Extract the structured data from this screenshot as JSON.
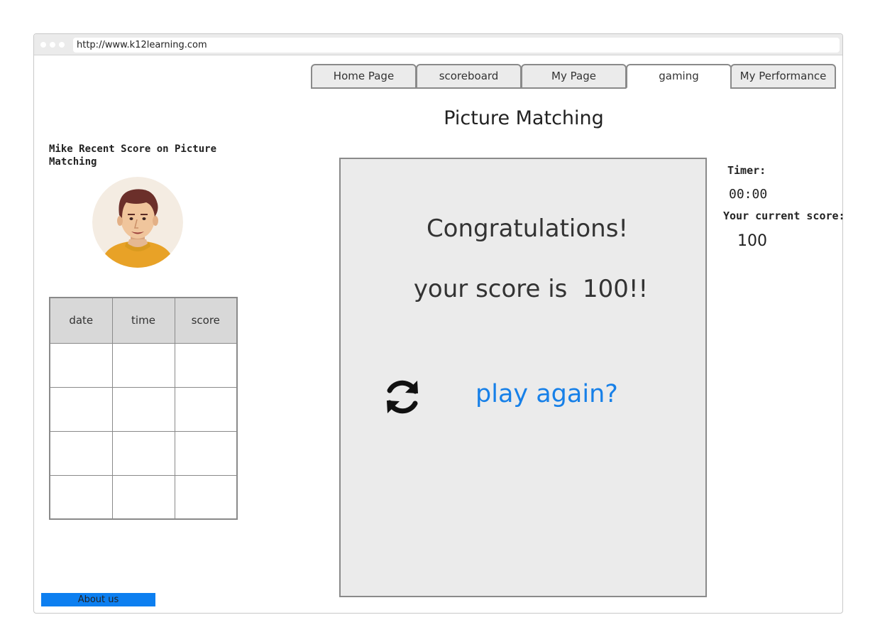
{
  "browser": {
    "url": "http://www.k12learning.com"
  },
  "tabs": [
    {
      "label": "Home Page",
      "active": false
    },
    {
      "label": "scoreboard",
      "active": false
    },
    {
      "label": "My Page",
      "active": false
    },
    {
      "label": "gaming",
      "active": true
    },
    {
      "label": "My Performance",
      "active": false
    }
  ],
  "page_title": "Picture Matching",
  "sidebar": {
    "recent_title": "Mike Recent Score on Picture Matching",
    "avatar_icon": "user-avatar",
    "table": {
      "headers": [
        "date",
        "time",
        "score"
      ],
      "rows": [
        [
          "",
          "",
          ""
        ],
        [
          "",
          "",
          ""
        ],
        [
          "",
          "",
          ""
        ],
        [
          "",
          "",
          ""
        ]
      ]
    },
    "about_label": "About us"
  },
  "game": {
    "congrats": "Congratulations!",
    "score_message": "your score is  100!!",
    "play_again": "play again?",
    "refresh_icon": "refresh-icon"
  },
  "status": {
    "timer_label": "Timer:",
    "timer_value": "00:00",
    "current_score_label": "Your current score:",
    "current_score_value": "100"
  },
  "colors": {
    "accent": "#0d7ff0",
    "link": "#1780e8",
    "panel": "#ebebeb"
  }
}
